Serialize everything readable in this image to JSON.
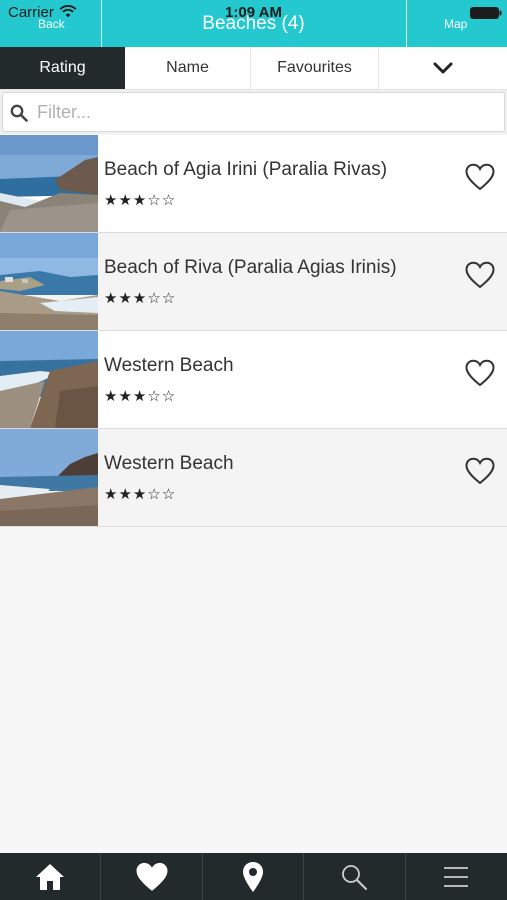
{
  "status_bar": {
    "carrier": "Carrier",
    "time": "1:09 AM",
    "wifi_icon": "wifi-icon",
    "battery_icon": "battery-icon"
  },
  "nav": {
    "back_label": "Back",
    "title": "Beaches (4)",
    "map_label": "Map",
    "accent_color": "#23c9cf"
  },
  "sort_tabs": [
    {
      "label": "Rating",
      "active": true
    },
    {
      "label": "Name",
      "active": false
    },
    {
      "label": "Favourites",
      "active": false
    },
    {
      "label": "",
      "icon": "chevron-down-icon"
    }
  ],
  "filter": {
    "placeholder": "Filter...",
    "value": "",
    "icon": "search-icon"
  },
  "beaches": [
    {
      "name": "Beach of Agia Irini (Paralia Rivas)",
      "stars": "★★★☆☆",
      "rating": 3,
      "max_rating": 5,
      "favourite": false
    },
    {
      "name": "Beach of Riva (Paralia Agias Irinis)",
      "stars": "★★★☆☆",
      "rating": 3,
      "max_rating": 5,
      "favourite": false
    },
    {
      "name": "Western Beach",
      "stars": "★★★☆☆",
      "rating": 3,
      "max_rating": 5,
      "favourite": false
    },
    {
      "name": "Western Beach",
      "stars": "★★★☆☆",
      "rating": 3,
      "max_rating": 5,
      "favourite": false
    }
  ],
  "bottom_nav": [
    {
      "icon": "home-icon"
    },
    {
      "icon": "heart-icon"
    },
    {
      "icon": "map-pin-icon"
    },
    {
      "icon": "search-icon"
    },
    {
      "icon": "menu-icon"
    }
  ]
}
